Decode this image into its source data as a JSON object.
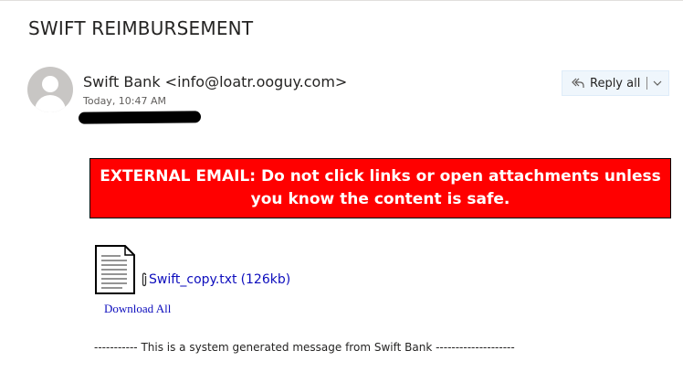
{
  "email": {
    "subject": "SWIFT REIMBURSEMENT",
    "sender": "Swift Bank <info@loatr.ooguy.com>",
    "date": "Today, 10:47 AM",
    "recipient_redacted": true
  },
  "toolbar": {
    "reply_all_label": "Reply all",
    "reply_icon": "reply-all-icon",
    "dropdown_icon": "chevron-down-icon"
  },
  "banner": {
    "text": "EXTERNAL EMAIL: Do not click links or open attachments unless you know the content is safe.",
    "background": "#ff0000",
    "text_color": "#ffffff"
  },
  "attachment": {
    "icon": "text-file-icon",
    "clip_icon": "paperclip-icon",
    "filename": "Swift_copy.txt",
    "size": "(126kb)",
    "download_all_label": "Download All",
    "link_color": "#0d0dbd"
  },
  "body": {
    "footer_text": "----------- This is a system generated message from Swift Bank --------------------"
  }
}
